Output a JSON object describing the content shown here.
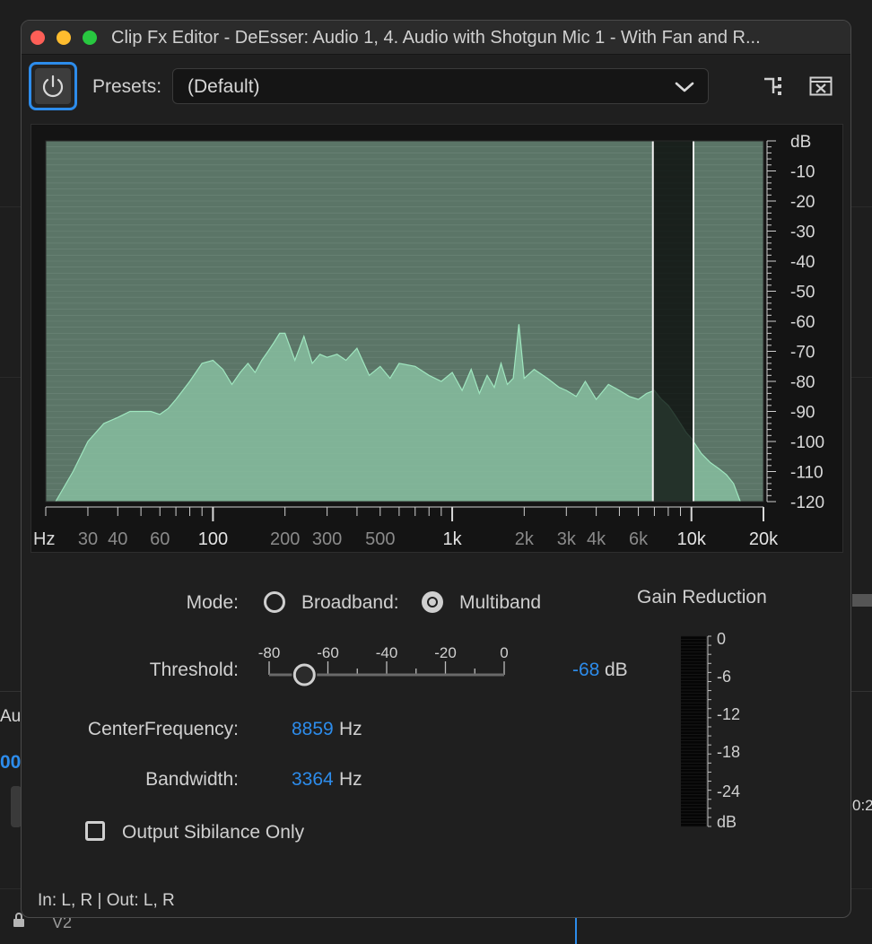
{
  "background": {
    "aud_label": "Au",
    "timecode_fragment": "00",
    "track": "V2",
    "time_fragment": "0:2"
  },
  "window": {
    "title": "Clip Fx Editor - DeEsser: Audio 1, 4. Audio with Shotgun Mic 1 - With Fan and R...",
    "traffic_lights": {
      "close": "#fe5f57",
      "minimize": "#febc2e",
      "maximize": "#28c840"
    }
  },
  "toolbar": {
    "power_icon": "power-icon",
    "presets_label": "Presets:",
    "presets_value": "(Default)",
    "routing_icon": "channel-routing-icon",
    "remove_icon": "remove-effect-icon"
  },
  "chart_data": {
    "type": "area",
    "xscale": "log",
    "xlim": [
      20,
      20000
    ],
    "ylim": [
      -120,
      0
    ],
    "x_unit_label": "Hz",
    "y_unit_label": "dB",
    "x_ticks": [
      {
        "value": 30,
        "label": "30",
        "major": false
      },
      {
        "value": 40,
        "label": "40",
        "major": false
      },
      {
        "value": 60,
        "label": "60",
        "major": false
      },
      {
        "value": 100,
        "label": "100",
        "major": true
      },
      {
        "value": 200,
        "label": "200",
        "major": false
      },
      {
        "value": 300,
        "label": "300",
        "major": false
      },
      {
        "value": 500,
        "label": "500",
        "major": false
      },
      {
        "value": 1000,
        "label": "1k",
        "major": true
      },
      {
        "value": 2000,
        "label": "2k",
        "major": false
      },
      {
        "value": 3000,
        "label": "3k",
        "major": false
      },
      {
        "value": 4000,
        "label": "4k",
        "major": false
      },
      {
        "value": 6000,
        "label": "6k",
        "major": false
      },
      {
        "value": 10000,
        "label": "10k",
        "major": true
      },
      {
        "value": 20000,
        "label": "20k",
        "major": true
      }
    ],
    "y_ticks": [
      -10,
      -20,
      -30,
      -40,
      -50,
      -60,
      -70,
      -80,
      -90,
      -100,
      -110,
      -120
    ],
    "y_tick_labels": [
      "-10",
      "-20",
      "-30",
      "-40",
      "-50",
      "-60",
      "-70",
      "-80",
      "-90",
      "-100",
      "-110",
      "-120"
    ],
    "band_hz": [
      6900,
      10200
    ],
    "series": [
      {
        "x": [
          22,
          26,
          30,
          35,
          40,
          45,
          50,
          55,
          60,
          65,
          70,
          80,
          90,
          100,
          110,
          120,
          130,
          140,
          150,
          160,
          170,
          180,
          190,
          200,
          220,
          240,
          260,
          280,
          300,
          330,
          360,
          400,
          450,
          500,
          550,
          600,
          700,
          800,
          900,
          1000,
          1100,
          1200,
          1300,
          1400,
          1500,
          1600,
          1700,
          1800,
          1900,
          2000,
          2200,
          2500,
          2800,
          3000,
          3300,
          3600,
          4000,
          4500,
          5000,
          5500,
          6000,
          6500,
          7000,
          7500,
          8000,
          8500,
          9000,
          9500,
          10000,
          11000,
          12000,
          13000,
          14000,
          15000,
          16000
        ],
        "y": [
          -120,
          -110,
          -100,
          -94,
          -92,
          -90,
          -90,
          -90,
          -91,
          -89,
          -86,
          -80,
          -74,
          -73,
          -76,
          -81,
          -77,
          -74,
          -77,
          -73,
          -70,
          -67,
          -64,
          -64,
          -73,
          -65,
          -74,
          -71,
          -72,
          -71,
          -73,
          -69,
          -78,
          -75,
          -79,
          -74,
          -75,
          -78,
          -80,
          -77,
          -83,
          -76,
          -84,
          -78,
          -82,
          -74,
          -81,
          -79,
          -61,
          -79,
          -76,
          -79,
          -82,
          -83,
          -85,
          -80,
          -86,
          -81,
          -83,
          -85,
          -86,
          -84,
          -83,
          -86,
          -88,
          -91,
          -94,
          -97,
          -99,
          -104,
          -107,
          -109,
          -111,
          -114,
          -120
        ]
      }
    ]
  },
  "controls": {
    "mode_label": "Mode:",
    "broadband_label": "Broadband:",
    "multiband_label": "Multiband",
    "mode_selected": "Multiband",
    "threshold_label": "Threshold:",
    "threshold_value": "-68",
    "threshold_unit": "dB",
    "threshold_range": [
      -80,
      0
    ],
    "threshold_scale_labels": [
      "-80",
      "-60",
      "-40",
      "-20",
      "0"
    ],
    "center_frequency_label": "CenterFrequency:",
    "center_frequency_value": "8859",
    "center_frequency_unit": "Hz",
    "bandwidth_label": "Bandwidth:",
    "bandwidth_value": "3364",
    "bandwidth_unit": "Hz",
    "output_sibilance_label": "Output Sibilance Only",
    "output_sibilance_checked": false
  },
  "gain_reduction": {
    "title": "Gain Reduction",
    "scale": [
      "0",
      "-6",
      "-12",
      "-18",
      "-24"
    ],
    "unit": "dB",
    "level": 0
  },
  "status": {
    "io": "In: L, R | Out: L, R"
  }
}
